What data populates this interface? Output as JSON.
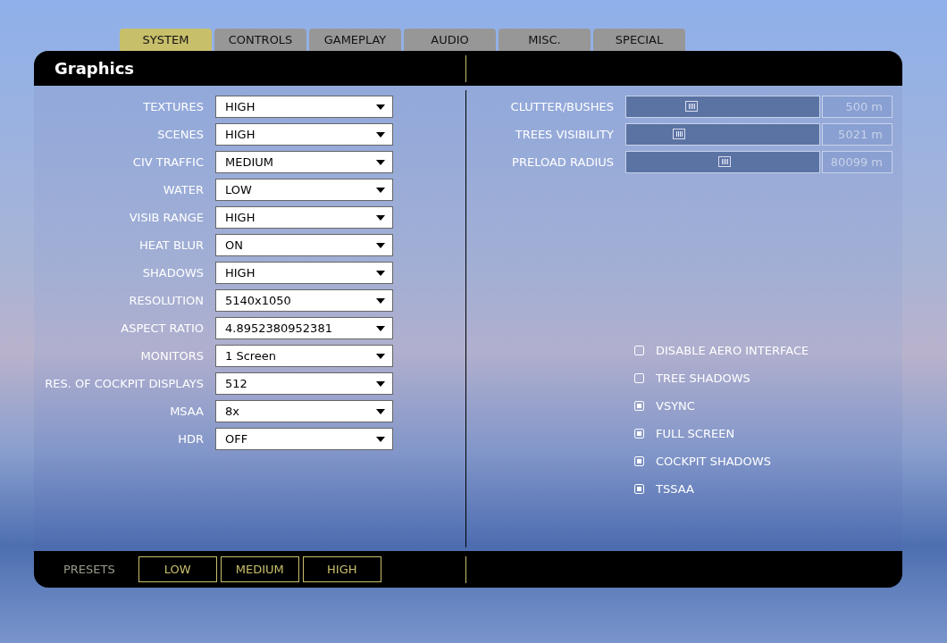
{
  "tabs": [
    {
      "label": "SYSTEM",
      "selected": true
    },
    {
      "label": "CONTROLS",
      "selected": false
    },
    {
      "label": "GAMEPLAY",
      "selected": false
    },
    {
      "label": "AUDIO",
      "selected": false
    },
    {
      "label": "MISC.",
      "selected": false
    },
    {
      "label": "SPECIAL",
      "selected": false
    }
  ],
  "header": {
    "title": "Graphics"
  },
  "settings": [
    {
      "label": "TEXTURES",
      "value": "HIGH"
    },
    {
      "label": "SCENES",
      "value": "HIGH"
    },
    {
      "label": "CIV TRAFFIC",
      "value": "MEDIUM"
    },
    {
      "label": "WATER",
      "value": "LOW"
    },
    {
      "label": "VISIB RANGE",
      "value": "HIGH"
    },
    {
      "label": "HEAT BLUR",
      "value": "ON"
    },
    {
      "label": "SHADOWS",
      "value": "HIGH"
    },
    {
      "label": "RESOLUTION",
      "value": "5140x1050"
    },
    {
      "label": "ASPECT RATIO",
      "value": "4.8952380952381"
    },
    {
      "label": "MONITORS",
      "value": "1 Screen"
    },
    {
      "label": "RES. OF COCKPIT DISPLAYS",
      "value": "512"
    },
    {
      "label": "MSAA",
      "value": "8x"
    },
    {
      "label": "HDR",
      "value": "OFF"
    }
  ],
  "sliders": [
    {
      "label": "CLUTTER/BUSHES",
      "level": 0.34,
      "reading": "500 m"
    },
    {
      "label": "TREES VISIBILITY",
      "level": 0.275,
      "reading": "5021 m"
    },
    {
      "label": "PRELOAD RADIUS",
      "level": 0.51,
      "reading": "80099 m"
    }
  ],
  "options": [
    {
      "label": "DISABLE AERO INTERFACE",
      "checked": false
    },
    {
      "label": "TREE SHADOWS",
      "checked": false
    },
    {
      "label": "VSYNC",
      "checked": true
    },
    {
      "label": "FULL SCREEN",
      "checked": true
    },
    {
      "label": "COCKPIT SHADOWS",
      "checked": true
    },
    {
      "label": "TSSAA",
      "checked": true
    }
  ],
  "footer": {
    "label": "PRESETS",
    "presets": [
      "LOW",
      "MEDIUM",
      "HIGH"
    ]
  }
}
